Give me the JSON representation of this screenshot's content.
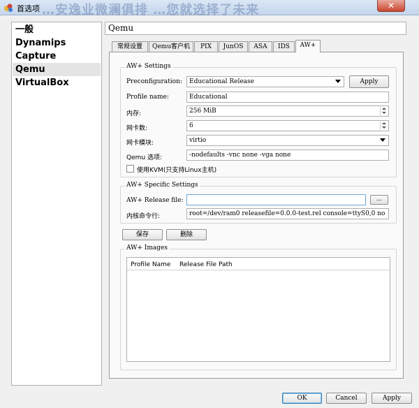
{
  "window": {
    "title": "首选项",
    "ghost_text": "…安逸业微澜俱排   …您就选择了未来"
  },
  "sidebar": {
    "items": [
      {
        "label": "一般"
      },
      {
        "label": "Dynamips"
      },
      {
        "label": "Capture"
      },
      {
        "label": "Qemu",
        "selected": true
      },
      {
        "label": "VirtualBox"
      }
    ]
  },
  "panel": {
    "title": "Qemu"
  },
  "tabs": [
    {
      "label": "常规设置"
    },
    {
      "label": "Qemu客户机"
    },
    {
      "label": "PIX"
    },
    {
      "label": "JunOS"
    },
    {
      "label": "ASA"
    },
    {
      "label": "IDS"
    },
    {
      "label": "AW+",
      "active": true
    }
  ],
  "aw_settings": {
    "group_label": "AW+ Settings",
    "preconfiguration_label": "Preconfiguration:",
    "preconfiguration_value": "Educational Release",
    "apply_label": "Apply",
    "profile_name_label": "Profile name:",
    "profile_name_value": "Educational",
    "memory_label": "内存:",
    "memory_value": "256 MiB",
    "nics_label": "网卡数:",
    "nics_value": "6",
    "nic_model_label": "网卡模块:",
    "nic_model_value": "virtio",
    "qemu_options_label": "Qemu 选项:",
    "qemu_options_value": "-nodefaults -vnc none -vga none",
    "kvm_label": "使用KVM(只支持Linux主机)",
    "kvm_checked": false
  },
  "aw_specific": {
    "group_label": "AW+ Specific Settings",
    "release_file_label": "AW+ Release file:",
    "release_file_value": "",
    "browse_label": "...",
    "kernel_cmdline_label": "内核命令行:",
    "kernel_cmdline_value": "root=/dev/ram0 releasefile=0.0.0-test.rel console=ttyS0,0 no"
  },
  "actions": {
    "save_label": "保存",
    "delete_label": "删除"
  },
  "images": {
    "group_label": "AW+ Images",
    "columns": [
      "Profile Name",
      "Release File Path"
    ],
    "rows": []
  },
  "footer": {
    "ok_label": "OK",
    "cancel_label": "Cancel",
    "apply_label": "Apply"
  }
}
